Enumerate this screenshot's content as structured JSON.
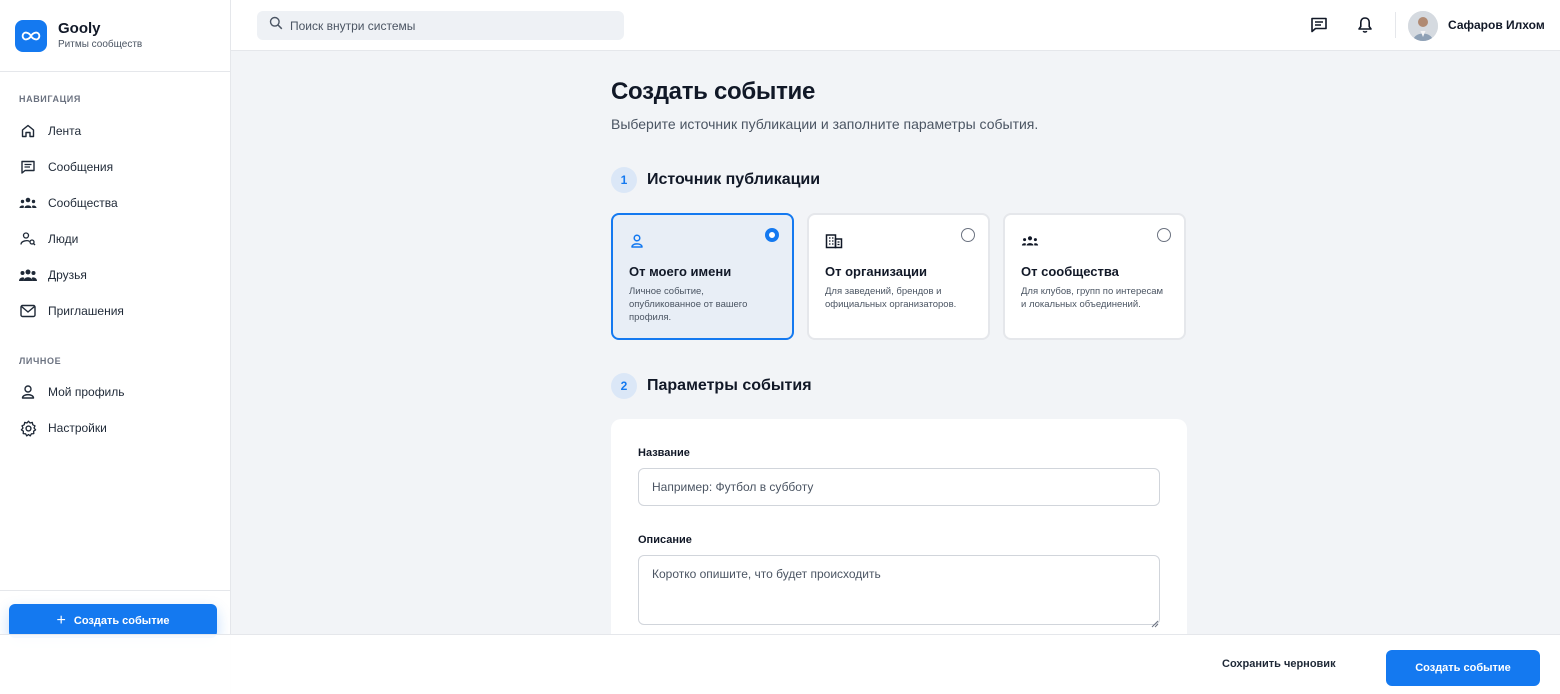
{
  "brand": {
    "name": "Gooly",
    "subtitle": "Ритмы сообществ",
    "accent": "#1479f0"
  },
  "search": {
    "placeholder": "Поиск внутри системы"
  },
  "header": {
    "user_name": "Сафаров Илхом",
    "icons": [
      "messages-icon",
      "bell-icon"
    ]
  },
  "sidebar": {
    "nav_section": "НАВИГАЦИЯ",
    "nav_items": [
      {
        "label": "Лента",
        "icon": "home-icon"
      },
      {
        "label": "Сообщения",
        "icon": "message-icon"
      },
      {
        "label": "Сообщества",
        "icon": "communities-icon"
      },
      {
        "label": "Люди",
        "icon": "people-search-icon"
      },
      {
        "label": "Друзья",
        "icon": "friends-icon"
      },
      {
        "label": "Приглашения",
        "icon": "mail-icon"
      }
    ],
    "personal_section": "ЛИЧНОЕ",
    "personal_items": [
      {
        "label": "Мой профиль",
        "icon": "profile-icon"
      },
      {
        "label": "Настройки",
        "icon": "settings-icon"
      }
    ],
    "create_button": "Создать событие"
  },
  "main": {
    "title": "Создать событие",
    "subtitle": "Выберите источник публикации и заполните параметры события.",
    "step1": {
      "number": "1",
      "title": "Источник публикации"
    },
    "sources": [
      {
        "title": "От моего имени",
        "description": "Личное событие, опубликованное от вашего профиля.",
        "selected": true,
        "icon": "person-icon"
      },
      {
        "title": "От организации",
        "description": "Для заведений, брендов и официальных организаторов.",
        "selected": false,
        "icon": "building-icon"
      },
      {
        "title": "От сообщества",
        "description": "Для клубов, групп по интересам и локальных объединений.",
        "selected": false,
        "icon": "group-icon"
      }
    ],
    "step2": {
      "number": "2",
      "title": "Параметры события"
    },
    "form": {
      "name_label": "Название",
      "name_placeholder": "Например: Футбол в субботу",
      "desc_label": "Описание",
      "desc_placeholder": "Коротко опишите, что будет происходить"
    }
  },
  "footer": {
    "draft_button": "Сохранить черновик",
    "create_button": "Создать событие"
  }
}
